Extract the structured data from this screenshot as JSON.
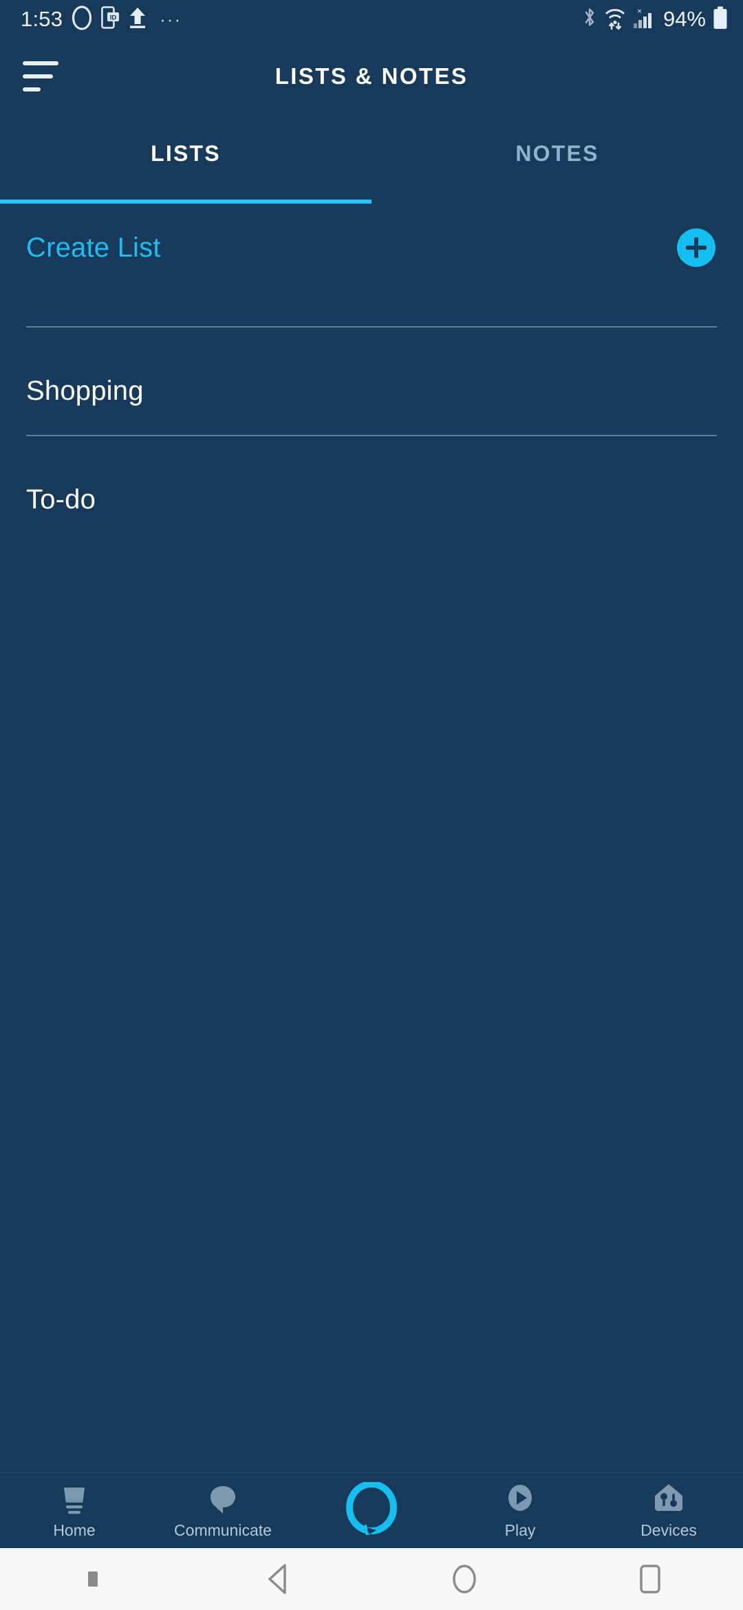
{
  "statusbar": {
    "time": "1:53",
    "battery_text": "94%",
    "overflow_dots": "···",
    "icons": {
      "alexa": "alexa-ring-icon",
      "cast_id": "phone-id-icon",
      "upload": "upload-arrow-icon",
      "bluetooth": "bluetooth-icon",
      "wifi": "wifi-data-icon",
      "signal": "cellular-signal-x-icon",
      "battery": "battery-icon"
    }
  },
  "header": {
    "title": "LISTS & NOTES",
    "menu_icon": "hamburger-menu-icon"
  },
  "tabs": [
    {
      "label": "LISTS",
      "active": true
    },
    {
      "label": "NOTES",
      "active": false
    }
  ],
  "main": {
    "create_row": {
      "label": "Create List",
      "add_icon": "plus-icon"
    },
    "lists": [
      {
        "label": "Shopping"
      },
      {
        "label": "To-do"
      }
    ]
  },
  "bottom_nav": [
    {
      "label": "Home",
      "icon": "echo-show-device-icon",
      "active": false
    },
    {
      "label": "Communicate",
      "icon": "speech-bubble-icon",
      "active": false
    },
    {
      "label": "",
      "icon": "alexa-ring-icon",
      "active": true
    },
    {
      "label": "Play",
      "icon": "play-circle-icon",
      "active": false
    },
    {
      "label": "Devices",
      "icon": "house-sliders-icon",
      "active": false
    }
  ],
  "android_nav": [
    {
      "icon": "keyboard-hide-dot-icon"
    },
    {
      "icon": "back-triangle-icon"
    },
    {
      "icon": "home-circle-icon"
    },
    {
      "icon": "recents-square-icon"
    }
  ],
  "colors": {
    "background": "#17395a",
    "accent_cyan": "#14bef0",
    "tab_active": "#ffffff",
    "tab_inactive": "#8fb4cb",
    "divider": "#5d7f99",
    "nav_inactive": "#7e98ad",
    "android_nav_bg": "#f7f8f9"
  }
}
